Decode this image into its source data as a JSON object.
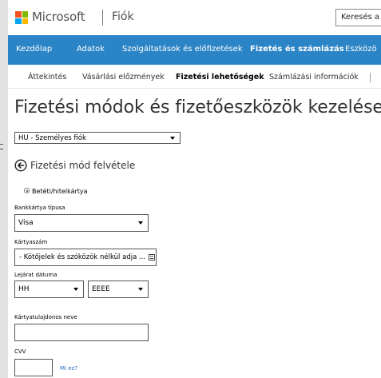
{
  "header": {
    "brand": "Microsoft",
    "app_title": "Fiók",
    "search_placeholder": "Keresés a"
  },
  "topnav": {
    "items": [
      {
        "label": "Kezdőlap"
      },
      {
        "label": "Adatok"
      },
      {
        "label": "Szolgáltatások és előfizetések"
      },
      {
        "label": "Fizetés és számlázás",
        "active": true
      },
      {
        "label": "Eszközö"
      }
    ]
  },
  "subnav": {
    "items": [
      {
        "label": "Áttekintés"
      },
      {
        "label": "Vásárlási előzmények"
      },
      {
        "label": "Fizetési lehetőségek",
        "active": true
      },
      {
        "label": "Számlázási információk"
      }
    ]
  },
  "main": {
    "page_title": "Fizetési módok és fizetőeszközök kezelése",
    "account_select": "HU - Személyes fiók",
    "add_method_title": "Fizetési mód felvétele",
    "radio_label": "Betéti/hitelkártya",
    "card_type_label": "Bankkártya típusa",
    "card_type_value": "Visa",
    "card_number_label": "Kártyaszám",
    "card_number_placeholder": "- Kötőjelek és szóközök nélkül adja ...",
    "expiry_label": "Lejárat dátuma",
    "expiry_month": "HH",
    "expiry_year": "EEEE",
    "holder_label": "Kártyatulajdonos neve",
    "cvv_label": "CVV",
    "whats_this": "Mi ez?"
  },
  "colors": {
    "nav_blue": "#2b84c6",
    "link_blue": "#2b6cc4",
    "background_gray": "#e2e2e2"
  }
}
